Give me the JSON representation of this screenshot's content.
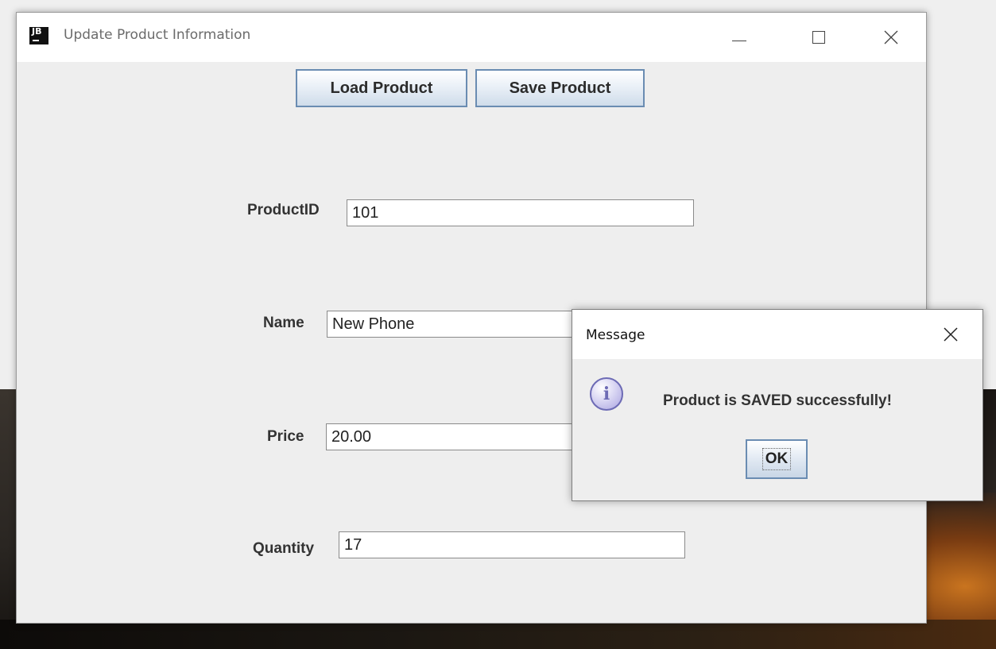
{
  "window": {
    "title": "Update Product Information",
    "app_icon_text": "JB",
    "controls": {
      "minimize_icon": "minimize-icon",
      "maximize_icon": "maximize-icon",
      "close_icon": "close-icon"
    }
  },
  "toolbar": {
    "load_label": "Load Product",
    "save_label": "Save Product"
  },
  "form": {
    "product_id": {
      "label": "ProductID",
      "value": "101"
    },
    "name": {
      "label": "Name",
      "value": "New Phone"
    },
    "price": {
      "label": "Price",
      "value": "20.00"
    },
    "quantity": {
      "label": "Quantity",
      "value": "17"
    }
  },
  "dialog": {
    "title": "Message",
    "message": "Product is SAVED successfully!",
    "ok_label": "OK",
    "icon": "info-icon"
  },
  "colors": {
    "button_border": "#6a8cb2",
    "info_icon": "#6d6bb5"
  }
}
